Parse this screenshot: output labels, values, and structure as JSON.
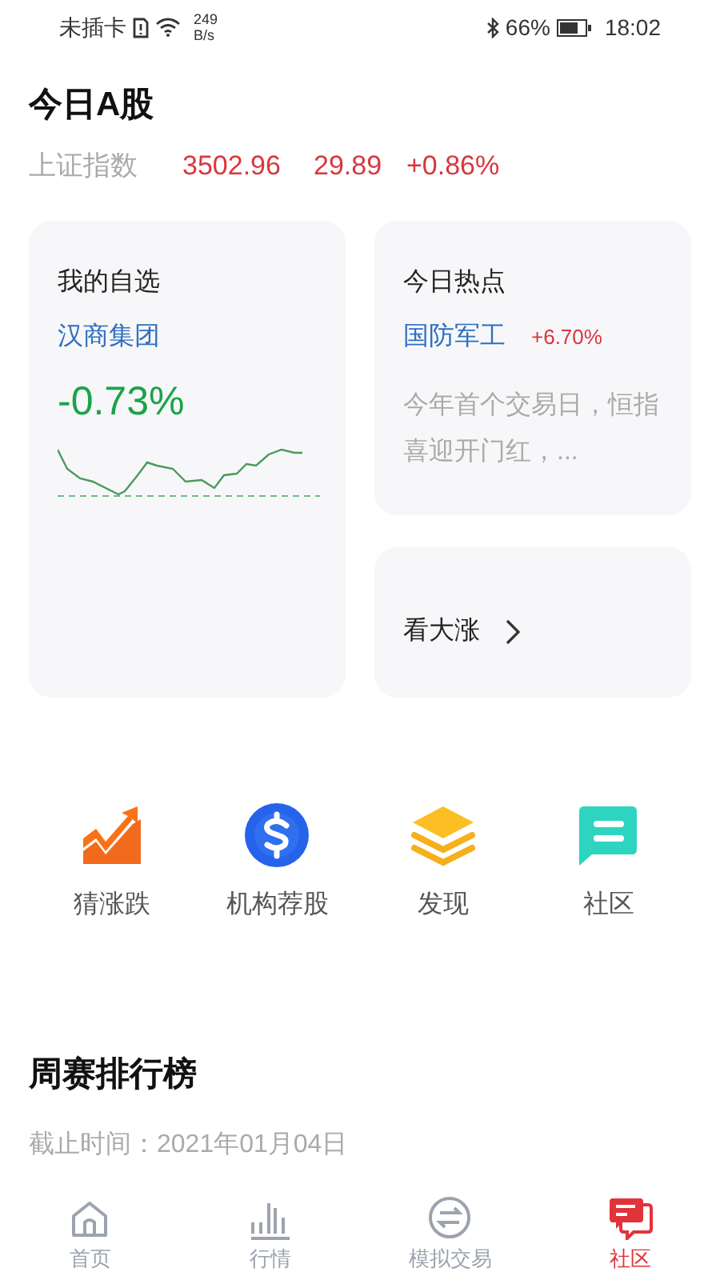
{
  "status_bar": {
    "carrier": "未插卡",
    "net_speed_value": "249",
    "net_speed_unit": "B/s",
    "battery": "66%",
    "time": "18:02"
  },
  "market": {
    "title": "今日A股",
    "index": {
      "name": "上证指数",
      "value": "3502.96",
      "change": "29.89",
      "percent": "+0.86%"
    }
  },
  "watchlist": {
    "title": "我的自选",
    "stock": "汉商集团",
    "percent": "-0.73%"
  },
  "hot": {
    "title": "今日热点",
    "sector": "国防军工",
    "percent": "+6.70%",
    "summary": "今年首个交易日，恒指喜迎开门红，..."
  },
  "gainers": {
    "label": "看大涨"
  },
  "shortcuts": [
    {
      "kind": "trend",
      "label": "猜涨跌"
    },
    {
      "kind": "dollar",
      "label": "机构荐股"
    },
    {
      "kind": "layers",
      "label": "发现"
    },
    {
      "kind": "chat",
      "label": "社区"
    }
  ],
  "ranking": {
    "title": "周赛排行榜",
    "deadline": "截止时间：2021年01月04日"
  },
  "tabs": [
    {
      "kind": "home",
      "label": "首页",
      "selected": false
    },
    {
      "kind": "bars",
      "label": "行情",
      "selected": false
    },
    {
      "kind": "swap",
      "label": "模拟交易",
      "selected": false
    },
    {
      "kind": "chat",
      "label": "社区",
      "selected": true
    }
  ]
}
